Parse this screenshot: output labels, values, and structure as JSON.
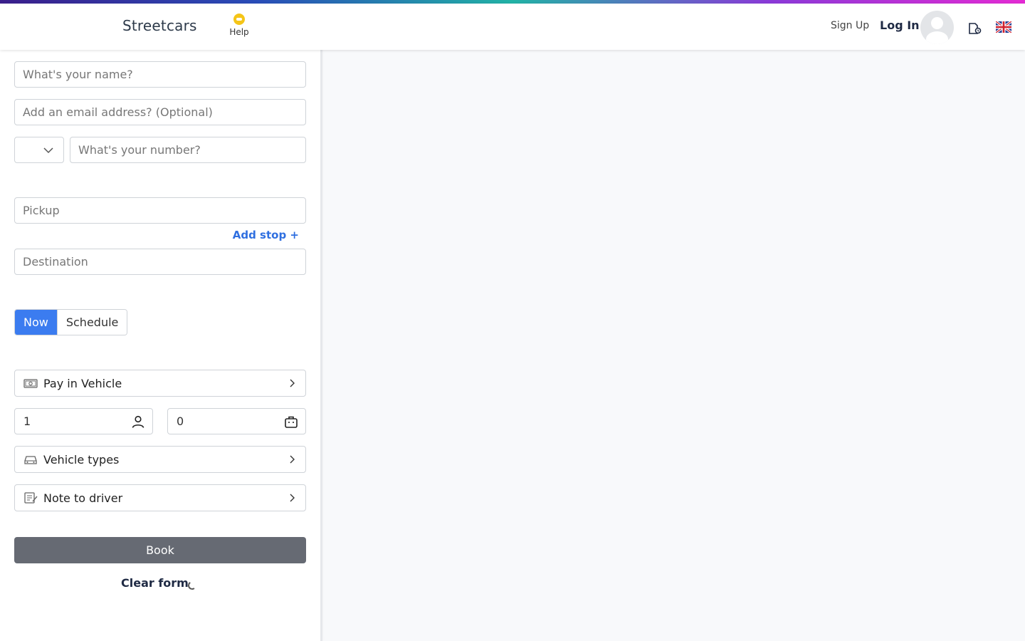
{
  "header": {
    "brand": "Streetcars",
    "help_label": "Help",
    "signup_label": "Sign Up",
    "login_label": "Log In"
  },
  "form": {
    "name_placeholder": "What's your name?",
    "email_placeholder": "Add an email address? (Optional)",
    "phone_placeholder": "What's your number?",
    "country_code": "",
    "pickup_placeholder": "Pickup",
    "add_stop_label": "Add stop +",
    "destination_placeholder": "Destination",
    "time_options": [
      "Now",
      "Schedule"
    ],
    "selected_time": "Now",
    "payment_label": "Pay in Vehicle",
    "passengers": "1",
    "luggage": "0",
    "vehicle_types_label": "Vehicle types",
    "note_label": "Note to driver",
    "book_label": "Book",
    "clear_label": "Clear form"
  },
  "colors": {
    "accent": "#3b7cf0",
    "link": "#2f6fe0",
    "book_button": "#666a73",
    "help_icon": "#f5c518"
  }
}
